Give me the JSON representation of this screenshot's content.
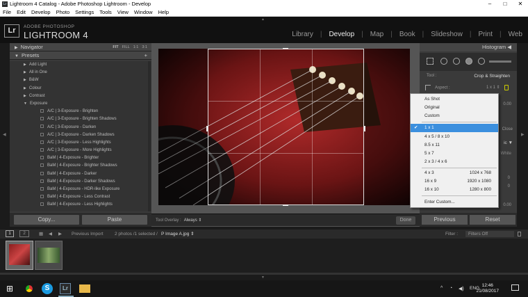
{
  "window": {
    "title": "Lightroom 4 Catalog - Adobe Photoshop Lightroom - Develop",
    "controls": [
      "–",
      "□",
      "✕"
    ]
  },
  "menu": [
    "File",
    "Edit",
    "Develop",
    "Photo",
    "Settings",
    "Tools",
    "View",
    "Window",
    "Help"
  ],
  "identity": {
    "logo": "Lr",
    "adobe": "ADOBE PHOTOSHOP",
    "product": "LIGHTROOM 4"
  },
  "modules": [
    "Library",
    "Develop",
    "Map",
    "Book",
    "Slideshow",
    "Print",
    "Web"
  ],
  "left": {
    "navigator": "Navigator",
    "nav_opts": [
      "FIT",
      "FILL",
      "1:1",
      "3:1"
    ],
    "presets": "Presets",
    "presets_add": "+",
    "folders": [
      "Add Light",
      "All in One",
      "B&W",
      "Colour",
      "Contrast"
    ],
    "open_folder": "Exposure",
    "children": [
      "A/C | 3-Exposure - Brighten",
      "A/C | 3-Exposure - Brighten Shadows",
      "A/C | 3-Exposure - Darken",
      "A/C | 3-Exposure - Darken Shadows",
      "A/C | 3-Exposure - Less Highlights",
      "A/C | 3-Exposure - More Highlights",
      "BaM | 4-Exposure - Brighter",
      "BaM | 4-Exposure - Brighter Shadows",
      "BaM | 4-Exposure - Darker",
      "BaM | 4-Exposure - Darker Shadows",
      "BaM | 4-Exposure - HDR-like Exposure",
      "BaM | 4-Exposure - Less Contrast",
      "BaM | 4-Exposure - Less Highlights"
    ],
    "copy": "Copy...",
    "paste": "Paste"
  },
  "toolbar": {
    "overlay_label": "Tool Overlay :",
    "overlay_value": "Always ⇕",
    "done": "Done"
  },
  "right": {
    "histogram": "Histogram ◀",
    "tool_label": "Tool :",
    "tool_name": "Crop & Straighten",
    "aspect_label": "Aspect :",
    "aspect_value": "1 x 1 ⇕",
    "val1": "0.00",
    "extra1": "Close",
    "extra2": "ic ▼",
    "extra3": "White",
    "zero1": "0",
    "zero2": "0",
    "val2": "0.00",
    "previous": "Previous",
    "reset": "Reset"
  },
  "dropdown": {
    "top": [
      "As Shot",
      "Original",
      "Custom"
    ],
    "selected": "1 x 1",
    "check": "✔",
    "ratios": [
      {
        "l": "4 x 5  /  8 x 10",
        "r": ""
      },
      {
        "l": "8.5 x 11",
        "r": ""
      },
      {
        "l": "5 x 7",
        "r": ""
      },
      {
        "l": "2 x 3  /  4 x 6",
        "r": ""
      }
    ],
    "screens": [
      {
        "l": "4 x 3",
        "r": "1024 x 768"
      },
      {
        "l": "16 x 9",
        "r": "1920 x 1080"
      },
      {
        "l": "16 x 10",
        "r": "1280 x 800"
      }
    ],
    "custom": "Enter Custom..."
  },
  "filmbar": {
    "screen1": "1",
    "screen2": "2",
    "previous_import": "Previous Import",
    "info": "2 photos /1 selected /",
    "filename": "P Image A.jpg ⇕",
    "filter_label": "Filter :",
    "filter_value": "Filters Off"
  },
  "taskbar": {
    "lang": "ENG",
    "time": "12:46",
    "date": "21/08/2017"
  }
}
